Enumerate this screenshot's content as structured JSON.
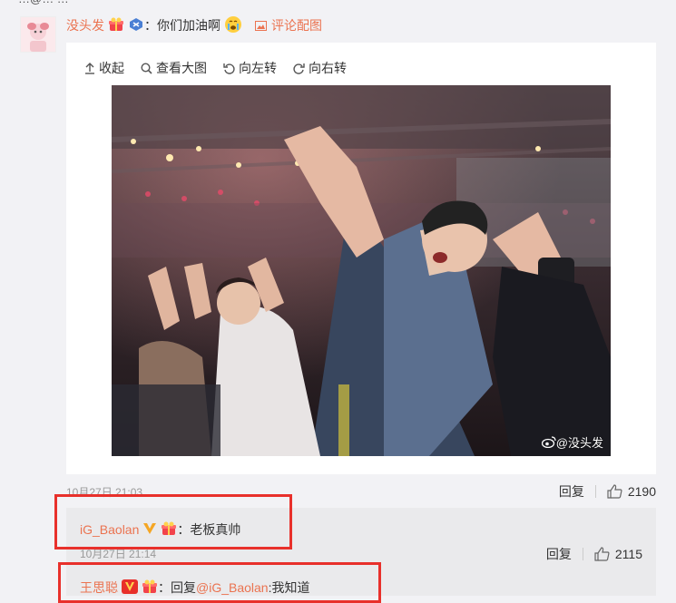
{
  "top_cut_text": "…@… …",
  "comment": {
    "user": "没头发",
    "separator": "：",
    "text": "你们加油啊",
    "pic_link": "评论配图"
  },
  "toolbar": {
    "collapse": "收起",
    "view_large": "查看大图",
    "rotate_left": "向左转",
    "rotate_right": "向右转"
  },
  "photo": {
    "watermark": "@没头发"
  },
  "meta": {
    "time": "10月27日 21:03",
    "reply": "回复",
    "likes": "2190"
  },
  "replies": [
    {
      "user": "iG_Baolan",
      "text": "：老板真帅",
      "time": "10月27日 21:14",
      "reply": "回复",
      "likes": "2115"
    },
    {
      "user": "王思聪",
      "prefix": "：回复",
      "mention": "@iG_Baolan",
      "text": ":我知道"
    }
  ],
  "colors": {
    "accent": "#eb7350",
    "highlight_box": "#e8302b",
    "vip_gold": "#f5a623"
  }
}
